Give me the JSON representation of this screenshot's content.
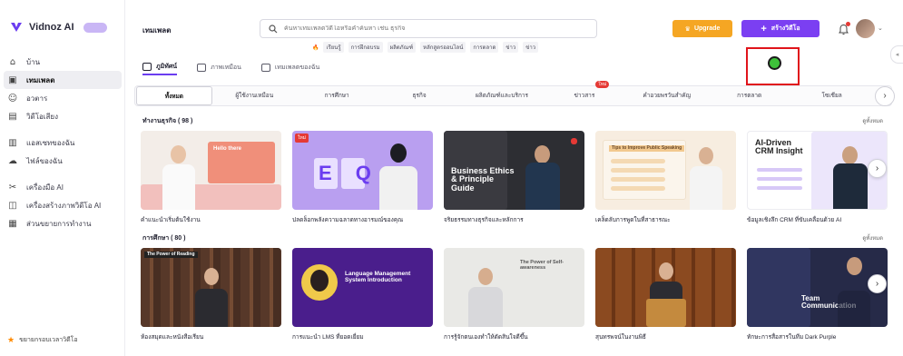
{
  "sidebar": {
    "brand": "Vidnoz AI",
    "items": [
      {
        "label": "บ้าน",
        "icon": "home-icon",
        "glyph": "⌂"
      },
      {
        "label": "เทมเพลต",
        "icon": "template-icon",
        "glyph": "▣",
        "active": true
      },
      {
        "label": "อวตาร",
        "icon": "avatar-icon",
        "glyph": "☺"
      },
      {
        "label": "วิดีโอเสียง",
        "icon": "voice-icon",
        "glyph": "▤"
      },
      {
        "label": "แอสเซทของฉัน",
        "icon": "assets-icon",
        "glyph": "▥"
      },
      {
        "label": "ไฟล์ของฉัน",
        "icon": "cloud-icon",
        "glyph": "☁"
      },
      {
        "label": "เครื่องมือ AI",
        "icon": "tools-icon",
        "glyph": "✂"
      },
      {
        "label": "เครื่องสร้างภาพวิดีโอ AI",
        "icon": "image-icon",
        "glyph": "◫"
      },
      {
        "label": "ส่วนขยายการทำงาน",
        "icon": "extension-icon",
        "glyph": "▦"
      }
    ],
    "footer": "ขยายกรอบเวลาวิดีโอ"
  },
  "header": {
    "title": "เทมเพลต",
    "search_placeholder": "ค้นหาเทมเพลตวิดีโอหรือคำค้นหา เช่น ธุรกิจ",
    "hot_tags": [
      "เรียนรู้",
      "การฝึกอบรม",
      "ผลิตภัณฑ์",
      "หลักสูตรออนไลน์",
      "การตลาด",
      "ข่าว",
      "ข่าว"
    ],
    "upgrade_label": "Upgrade",
    "create_label": "สร้างวิดีโอ"
  },
  "view_tabs": [
    {
      "label": "ภูมิทัศน์",
      "active": true
    },
    {
      "label": "ภาพเหมือน",
      "active": false
    },
    {
      "label": "เทมเพลตของฉัน",
      "active": false
    }
  ],
  "categories": [
    {
      "label": "ทั้งหมด",
      "active": true
    },
    {
      "label": "ผู้ใช้งานเหมือน"
    },
    {
      "label": "การศึกษา"
    },
    {
      "label": "ธุรกิจ"
    },
    {
      "label": "ผลิตภัณฑ์และบริการ"
    },
    {
      "label": "ข่าวสาร",
      "badge": "ใหม่"
    },
    {
      "label": "คำอวยพรวันสำคัญ"
    },
    {
      "label": "การตลาด"
    },
    {
      "label": "โซเชียล"
    }
  ],
  "sections": [
    {
      "title": "ทำงานธุรกิจ ( 98 )",
      "see_all": "ดูทั้งหมด",
      "cards": [
        {
          "title": "คำแนะนำเริ่มต้นใช้งาน",
          "slide": "Hello there"
        },
        {
          "title": "ปลดล็อกพลังความฉลาดทางอารมณ์ของคุณ",
          "slide": "E Q",
          "badge": "ใหม่"
        },
        {
          "title": "จริยธรรมทางธุรกิจและหลักการ",
          "slide": "Business Ethics & Principle Guide"
        },
        {
          "title": "เคล็ดลับการพูดในที่สาธารณะ",
          "slide": "Tips to Improve Public Speaking"
        },
        {
          "title": "ข้อมูลเชิงลึก CRM ที่ขับเคลื่อนด้วย AI",
          "slide": "AI-Driven CRM Insight"
        }
      ]
    },
    {
      "title": "การศึกษา ( 80 )",
      "see_all": "ดูทั้งหมด",
      "cards": [
        {
          "title": "ห้องสมุดและหนังสือเรียน",
          "slide": "The Power of Reading"
        },
        {
          "title": "การแนะนำ LMS ที่ยอดเยี่ยม",
          "slide": "Language Management System Introduction"
        },
        {
          "title": "การรู้จักตนเองทำให้ตัดสินใจดีขึ้น",
          "slide": "The Power of Self-awareness"
        },
        {
          "title": "สุนทรพจน์ในงานพิธี",
          "slide": ""
        },
        {
          "title": "ทักษะการสื่อสารในทีม Dark Purple",
          "slide": "Team Communication"
        }
      ]
    }
  ],
  "colors": {
    "accent": "#7b3ff2",
    "upgrade": "#f5a623",
    "indicator": "#3ec23a",
    "highlight_border": "#e0141b"
  }
}
